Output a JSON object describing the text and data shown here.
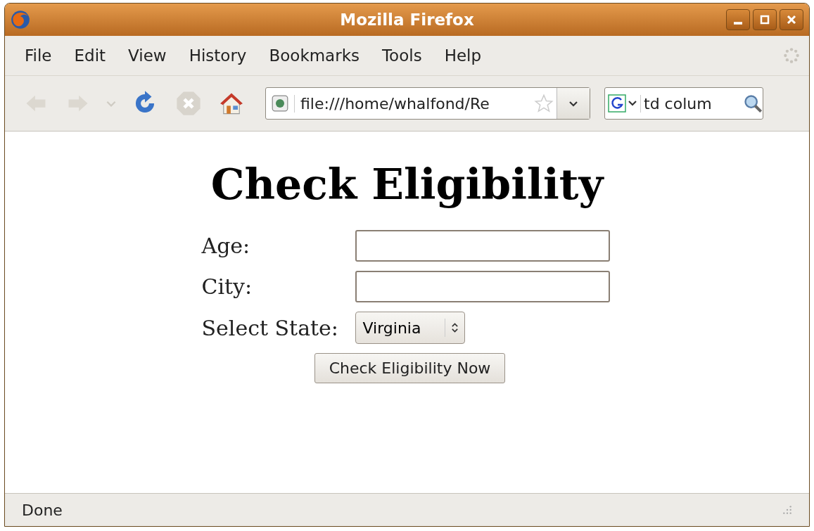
{
  "window": {
    "title": "Mozilla Firefox"
  },
  "menu": [
    {
      "label": "File"
    },
    {
      "label": "Edit"
    },
    {
      "label": "View"
    },
    {
      "label": "History"
    },
    {
      "label": "Bookmarks"
    },
    {
      "label": "Tools"
    },
    {
      "label": "Help"
    }
  ],
  "toolbar": [
    {
      "kind": "back",
      "disabled": true
    },
    {
      "kind": "forward",
      "disabled": true
    },
    {
      "kind": "history",
      "disabled": true
    },
    {
      "kind": "reload",
      "disabled": false
    },
    {
      "kind": "stop",
      "disabled": true
    },
    {
      "kind": "home",
      "disabled": false
    }
  ],
  "address": {
    "value": "file:///home/whalfond/Re"
  },
  "search": {
    "value": "td colum"
  },
  "page": {
    "heading": "Check Eligibility",
    "fields": [
      {
        "kind": "text",
        "label": "Age:"
      },
      {
        "kind": "text",
        "label": "City:"
      },
      {
        "kind": "select",
        "label": "Select State:",
        "value": "Virginia"
      }
    ],
    "submit": "Check Eligibility Now"
  },
  "status_bar": {
    "text": "Done"
  }
}
